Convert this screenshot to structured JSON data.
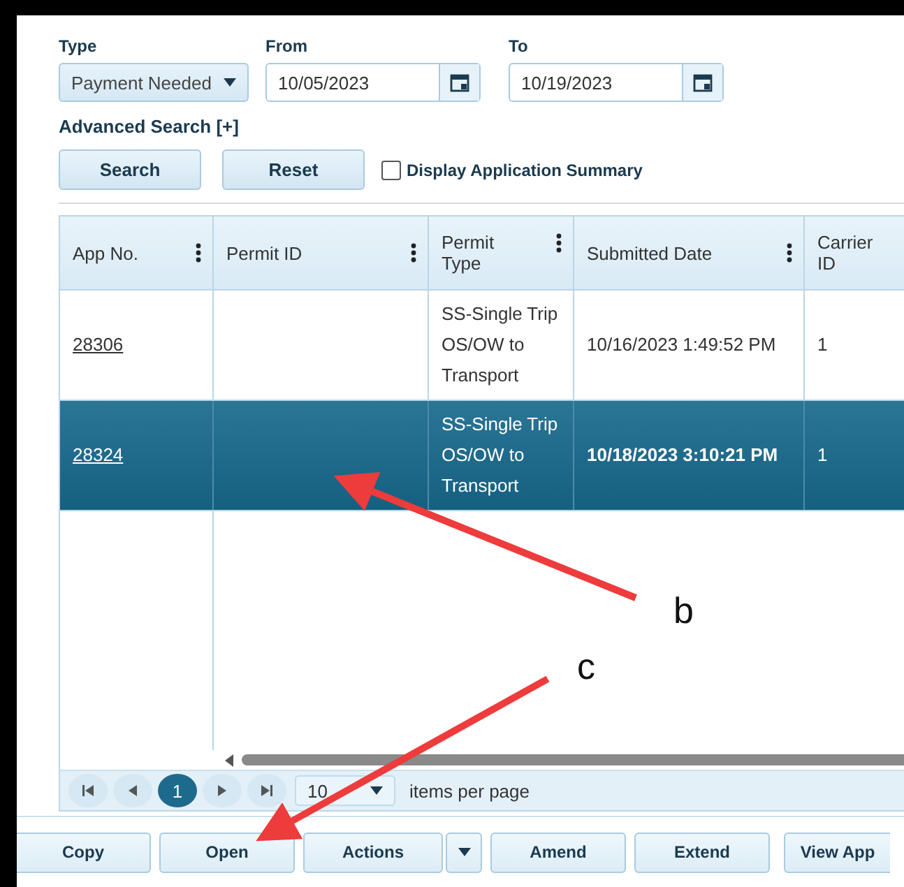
{
  "filters": {
    "type": {
      "label": "Type",
      "value": "Payment Needed"
    },
    "from": {
      "label": "From",
      "value": "10/05/2023"
    },
    "to": {
      "label": "To",
      "value": "10/19/2023"
    }
  },
  "advanced_search": "Advanced Search [+]",
  "buttons": [
    "Search",
    "Reset"
  ],
  "summary_checkbox": {
    "label": "Display Application Summary",
    "checked": false
  },
  "table": {
    "columns": [
      "App No.",
      "Permit ID",
      "Permit Type",
      "Submitted Date",
      "Carrier ID"
    ],
    "rows": [
      {
        "selected": false,
        "cells": [
          "28306",
          "",
          "SS-Single Trip OS/OW to Transport",
          "10/16/2023 1:49:52 PM",
          "1"
        ]
      },
      {
        "selected": true,
        "cells": [
          "28324",
          "",
          "SS-Single Trip OS/OW to Transport",
          "10/18/2023 3:10:21 PM",
          "1"
        ]
      }
    ]
  },
  "pager": {
    "pages": [
      {
        "label": "1",
        "selected": true
      }
    ],
    "page_size": "10",
    "items_per_page": "items per page"
  },
  "toolbar": [
    {
      "label": "Copy",
      "kind": "button"
    },
    {
      "label": "Open",
      "kind": "button"
    },
    {
      "label": "Actions",
      "kind": "split"
    },
    {
      "label": "Amend",
      "kind": "button"
    },
    {
      "label": "Extend",
      "kind": "button"
    },
    {
      "label": "View App",
      "kind": "button"
    }
  ],
  "annotations": [
    {
      "label": "b"
    },
    {
      "label": "c"
    }
  ]
}
